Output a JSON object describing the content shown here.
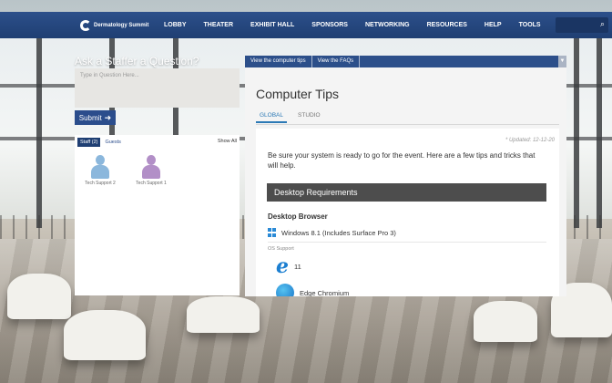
{
  "nav": {
    "logo_title": "Dermatology Summit",
    "items": [
      "LOBBY",
      "THEATER",
      "EXHIBIT HALL",
      "SPONSORS",
      "NETWORKING",
      "RESOURCES",
      "HELP",
      "TOOLS"
    ]
  },
  "ask": {
    "title": "Ask a Staffer a Question?",
    "placeholder": "Type in Question Here...",
    "submit_label": "Submit"
  },
  "staff": {
    "tab_staff": "Staff (2)",
    "tab_guests": "Guests",
    "show_all": "Show All",
    "members": [
      {
        "name": "Tech Support 2",
        "avatar_color": "#8bb7dc"
      },
      {
        "name": "Tech Support 1",
        "avatar_color": "#b28fc7"
      }
    ]
  },
  "tips": {
    "header_links": [
      "View the computer tips",
      "View the FAQs"
    ],
    "title": "Computer Tips",
    "tabs": [
      "GLOBAL",
      "STUDIO"
    ],
    "updated": "* Updated: 12-12-20",
    "intro": "Be sure your system is ready to go for the event. Here are a few tips and tricks that will help.",
    "section_title": "Desktop Requirements",
    "browser_heading": "Desktop Browser",
    "windows_item": "Windows 8.1 (Includes Surface Pro 3)",
    "os_support_label": "OS Support",
    "ie_version": "11",
    "edge_label": "Edge Chromium"
  },
  "colors": {
    "nav_bg": "#1f3f73",
    "accent": "#2b4d8c",
    "tab_active": "#2b79b5"
  }
}
